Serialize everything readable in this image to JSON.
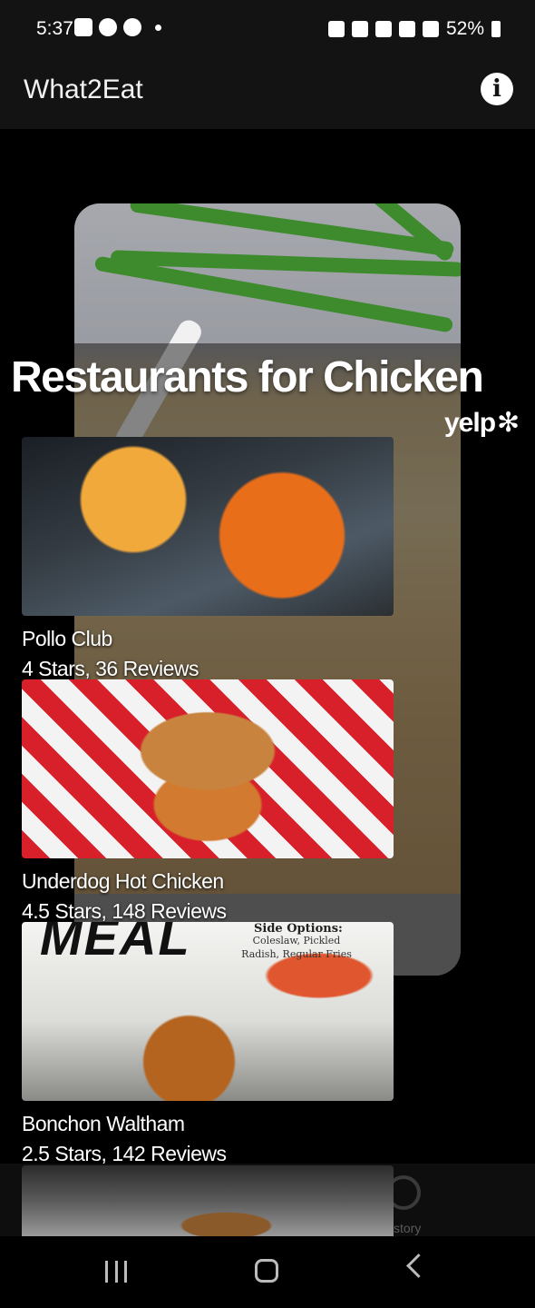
{
  "status_bar": {
    "time": "5:37",
    "battery": "52%",
    "left_icons": [
      "gallery-icon",
      "alert-icon",
      "talk-icon",
      "dot-icon"
    ],
    "right_icons": [
      "alarm-icon",
      "bluetooth-icon",
      "mute-icon",
      "wifi-icon",
      "signal-icon",
      "battery-icon"
    ]
  },
  "app_bar": {
    "title": "What2Eat",
    "info_glyph": "i"
  },
  "main": {
    "heading": "Restaurants for Chicken",
    "yelp_logo_text": "yelp",
    "yelp_burst": "✻"
  },
  "restaurants": [
    {
      "name": "Pollo Club",
      "meta": "4 Stars, 36 Reviews"
    },
    {
      "name": "Underdog Hot Chicken",
      "meta": "4.5 Stars, 148 Reviews"
    },
    {
      "name": "Bonchon Waltham",
      "meta": "2.5 Stars, 142 Reviews"
    }
  ],
  "bonchon_image_text": {
    "meal": "MEAL",
    "side_title": "Side Options:",
    "side_items": "Coleslaw, Pickled Radish, Regular Fries"
  },
  "bottom_nav": {
    "history_label": "story"
  }
}
